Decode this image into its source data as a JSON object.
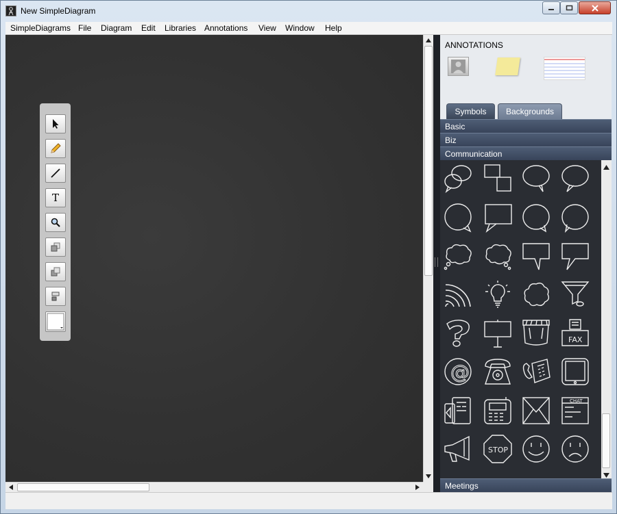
{
  "window": {
    "title": "New SimpleDiagram",
    "app_icon": "simplediagrams-logo-icon",
    "controls": [
      "minimize-icon",
      "maximize-icon",
      "close-icon"
    ]
  },
  "menubar": {
    "items": [
      "SimpleDiagrams",
      "File",
      "Diagram",
      "Edit",
      "Libraries",
      "Annotations",
      "View",
      "Window",
      "Help"
    ]
  },
  "canvas": {
    "background": "chalkboard",
    "color": "#333333"
  },
  "toolbox": {
    "tools": [
      {
        "name": "pointer-tool",
        "icon": "arrow-cursor-icon"
      },
      {
        "name": "pencil-tool",
        "icon": "pencil-icon"
      },
      {
        "name": "line-tool",
        "icon": "line-icon"
      },
      {
        "name": "text-tool",
        "icon": "text-t-icon",
        "glyph": "T"
      },
      {
        "name": "zoom-tool",
        "icon": "magnifier-icon"
      },
      {
        "name": "bring-forward-tool",
        "icon": "bring-forward-icon"
      },
      {
        "name": "send-backward-tool",
        "icon": "send-backward-icon"
      },
      {
        "name": "align-tool",
        "icon": "align-icon"
      },
      {
        "name": "color-picker",
        "icon": "color-swatch-icon",
        "color": "#ffffff"
      }
    ]
  },
  "panel": {
    "annotations_heading": "ANNOTATIONS",
    "annotations": [
      "person-card-icon",
      "sticky-note-icon",
      "index-card-icon"
    ],
    "tabs": [
      {
        "label": "Symbols",
        "selected": true
      },
      {
        "label": "Backgrounds",
        "selected": false
      }
    ],
    "categories": [
      "Basic",
      "Biz",
      "Communication"
    ],
    "footer_category": "Meetings",
    "symbols": [
      {
        "name": "speech-bubbles-icon"
      },
      {
        "name": "overlapping-squares-icon"
      },
      {
        "name": "speech-bubble-icon"
      },
      {
        "name": "speech-bubble-left-icon"
      },
      {
        "name": "round-speech-bubble-icon"
      },
      {
        "name": "rectangle-speech-bubble-icon"
      },
      {
        "name": "oval-speech-bubble-icon"
      },
      {
        "name": "oval-speech-bubble-right-icon"
      },
      {
        "name": "thought-cloud-icon"
      },
      {
        "name": "thought-cloud-right-icon"
      },
      {
        "name": "square-callout-icon"
      },
      {
        "name": "square-callout-left-icon"
      },
      {
        "name": "wireless-signal-icon"
      },
      {
        "name": "light-bulb-icon"
      },
      {
        "name": "cloud-icon"
      },
      {
        "name": "funnel-icon"
      },
      {
        "name": "question-mark-icon"
      },
      {
        "name": "signboard-icon"
      },
      {
        "name": "awning-shop-icon"
      },
      {
        "name": "fax-machine-icon",
        "label": "FAX"
      },
      {
        "name": "at-sign-icon",
        "label": "@"
      },
      {
        "name": "rotary-phone-icon"
      },
      {
        "name": "desk-phone-icon"
      },
      {
        "name": "tablet-icon"
      },
      {
        "name": "mobile-devices-icon"
      },
      {
        "name": "calculator-phone-icon"
      },
      {
        "name": "envelope-icon"
      },
      {
        "name": "chat-window-icon",
        "label": "CHAT"
      },
      {
        "name": "megaphone-icon"
      },
      {
        "name": "stop-sign-icon",
        "label": "STOP"
      },
      {
        "name": "smiley-face-icon"
      },
      {
        "name": "sad-face-icon"
      }
    ]
  },
  "status_bar": {
    "text": ""
  }
}
